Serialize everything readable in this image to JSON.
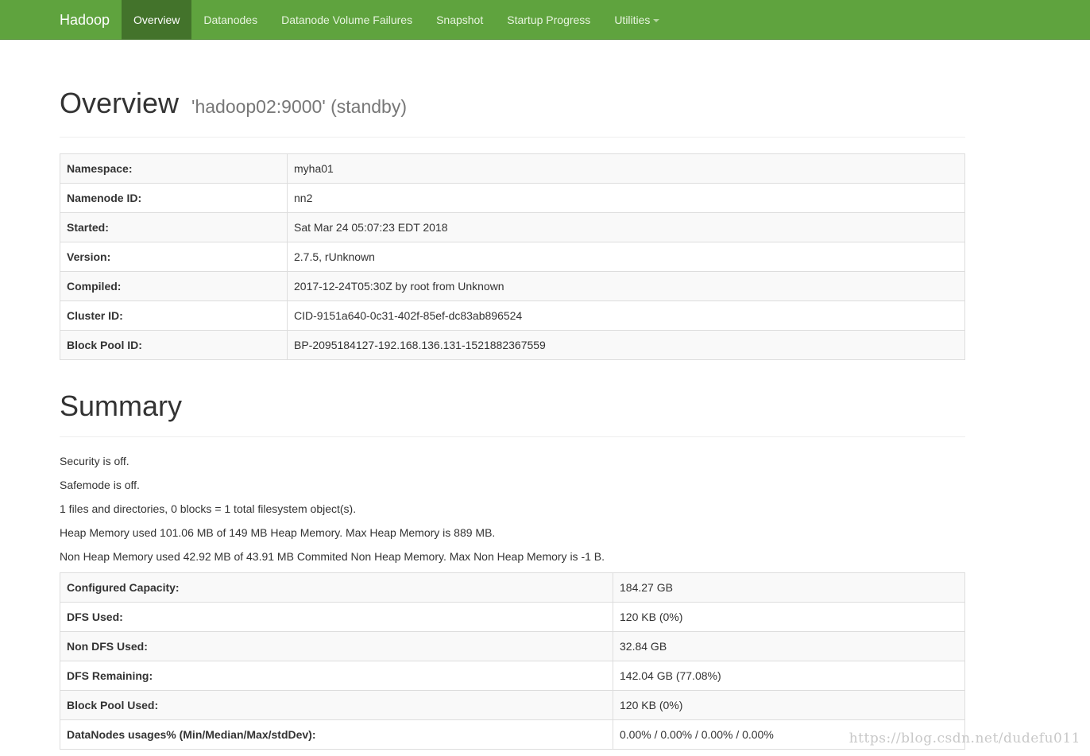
{
  "navbar": {
    "brand": "Hadoop",
    "items": [
      {
        "label": "Overview",
        "active": true
      },
      {
        "label": "Datanodes"
      },
      {
        "label": "Datanode Volume Failures"
      },
      {
        "label": "Snapshot"
      },
      {
        "label": "Startup Progress"
      },
      {
        "label": "Utilities",
        "dropdown": true
      }
    ]
  },
  "overview": {
    "title": "Overview",
    "subtitle": "'hadoop02:9000' (standby)",
    "rows": [
      {
        "label": "Namespace:",
        "value": "myha01"
      },
      {
        "label": "Namenode ID:",
        "value": "nn2"
      },
      {
        "label": "Started:",
        "value": "Sat Mar 24 05:07:23 EDT 2018"
      },
      {
        "label": "Version:",
        "value": "2.7.5, rUnknown"
      },
      {
        "label": "Compiled:",
        "value": "2017-12-24T05:30Z by root from Unknown"
      },
      {
        "label": "Cluster ID:",
        "value": "CID-9151a640-0c31-402f-85ef-dc83ab896524"
      },
      {
        "label": "Block Pool ID:",
        "value": "BP-2095184127-192.168.136.131-1521882367559"
      }
    ]
  },
  "summary": {
    "title": "Summary",
    "lines": [
      "Security is off.",
      "Safemode is off.",
      "1 files and directories, 0 blocks = 1 total filesystem object(s).",
      "Heap Memory used 101.06 MB of 149 MB Heap Memory. Max Heap Memory is 889 MB.",
      "Non Heap Memory used 42.92 MB of 43.91 MB Commited Non Heap Memory. Max Non Heap Memory is -1 B."
    ],
    "rows": [
      {
        "label": "Configured Capacity:",
        "value": "184.27 GB"
      },
      {
        "label": "DFS Used:",
        "value": "120 KB (0%)"
      },
      {
        "label": "Non DFS Used:",
        "value": "32.84 GB"
      },
      {
        "label": "DFS Remaining:",
        "value": "142.04 GB (77.08%)"
      },
      {
        "label": "Block Pool Used:",
        "value": "120 KB (0%)"
      },
      {
        "label": "DataNodes usages% (Min/Median/Max/stdDev):",
        "value": "0.00% / 0.00% / 0.00% / 0.00%"
      }
    ]
  },
  "watermark": "https://blog.csdn.net/dudefu011",
  "colors": {
    "navbar": "#5fa33e",
    "navbar_active": "#43732b"
  }
}
